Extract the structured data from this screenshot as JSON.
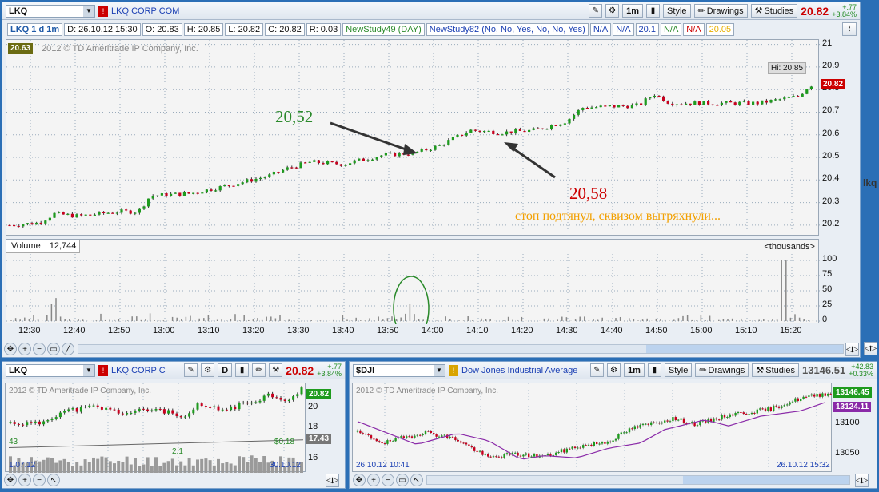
{
  "main": {
    "symbol": "LKQ",
    "company": "LKQ CORP COM",
    "toolbar": {
      "period": "1m",
      "style": "Style",
      "drawings": "Drawings",
      "studies": "Studies"
    },
    "last": "20.82",
    "change": "+.77",
    "change_pct": "+3.84%",
    "ohlc": [
      "LKQ 1 d 1m",
      "D: 26.10.12 15:30",
      "O: 20.83",
      "H: 20.85",
      "L: 20.82",
      "C: 20.82",
      "R: 0.03",
      "NewStudy49 (DAY)",
      "NewStudy82 (No, No, Yes, No, No, Yes)",
      "N/A",
      "N/A",
      "20.1",
      "N/A",
      "N/A",
      "20.05"
    ],
    "copyright": "2012 © TD Ameritrade IP Company, Inc.",
    "left_tag": "20.63",
    "hi_label": "Hi: 20.85",
    "price_tag": "20.82",
    "y_ticks": [
      "21",
      "20.9",
      "20.8",
      "20.7",
      "20.6",
      "20.5",
      "20.4",
      "20.3",
      "20.2"
    ],
    "x_ticks": [
      "12:30",
      "12:40",
      "12:50",
      "13:00",
      "13:10",
      "13:20",
      "13:30",
      "13:40",
      "13:50",
      "14:00",
      "14:10",
      "14:20",
      "14:30",
      "14:40",
      "14:50",
      "15:00",
      "15:10",
      "15:20"
    ],
    "side_text": "lkq",
    "annotations": {
      "a1": "20,52",
      "a2": "20,58",
      "note": "стоп подтянул, сквизом вытряхнули..."
    },
    "volume": {
      "label": "Volume",
      "value": "12,744",
      "units": "<thousands>",
      "ticks": [
        "100",
        "75",
        "50",
        "25",
        "0"
      ]
    }
  },
  "bl": {
    "symbol": "LKQ",
    "company": "LKQ CORP C",
    "period": "D",
    "last": "20.82",
    "change": "+.77",
    "change_pct": "+3.84%",
    "copyright": "2012 © TD Ameritrade IP Company, Inc.",
    "price_tag": "20.82",
    "ma_tag": "17.43",
    "y_ticks": [
      "20",
      "18",
      "16"
    ],
    "labels": {
      "l1": "43",
      "l2": "$0.18",
      "l3": "2.1",
      "d1": "1.07.12",
      "d2": "30.10.12"
    }
  },
  "br": {
    "symbol": "$DJI",
    "company": "Dow Jones Industrial Average",
    "toolbar": {
      "period": "1m",
      "style": "Style",
      "drawings": "Drawings",
      "studies": "Studies"
    },
    "last": "13146.51",
    "change": "+42.83",
    "change_pct": "+0.33%",
    "copyright": "2012 © TD Ameritrade IP Company, Inc.",
    "price_tag": "13146.45",
    "ma_tag": "13124.11",
    "y_ticks": [
      "13100",
      "13050"
    ],
    "d1": "26.10.12 10:41",
    "d2": "26.10.12 15:32"
  },
  "colors": {
    "up": "#1e9b1e",
    "down": "#c8001e",
    "bg": "#2b6fb6"
  }
}
